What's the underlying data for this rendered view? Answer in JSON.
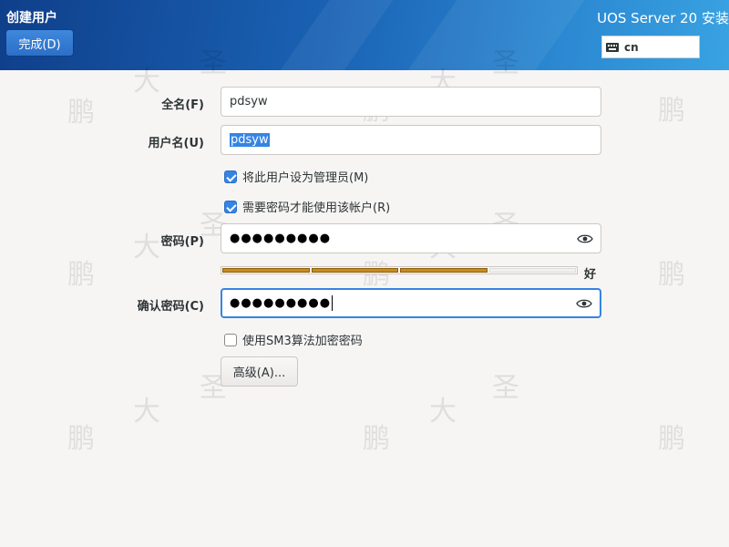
{
  "header": {
    "page_title": "创建用户",
    "done_label": "完成(D)",
    "product_title": "UOS Server 20 安装",
    "keyboard_layout": "cn",
    "keyboard_icon": "keyboard-icon"
  },
  "watermark": [
    "鹏",
    "大",
    "圣"
  ],
  "form": {
    "fullname": {
      "label": "全名(F)",
      "value": "pdsyw"
    },
    "username": {
      "label": "用户名(U)",
      "value": "pdsyw"
    },
    "admin_check": {
      "label": "将此用户设为管理员(M)",
      "checked": true
    },
    "require_pw_check": {
      "label": "需要密码才能使用该帐户(R)",
      "checked": true
    },
    "password": {
      "label": "密码(P)",
      "masked": "●●●●●●●●●",
      "reveal_icon": "eye-icon"
    },
    "strength": {
      "filled_segments": 3,
      "total_segments": 4,
      "label": "好"
    },
    "confirm": {
      "label": "确认密码(C)",
      "masked": "●●●●●●●●●",
      "reveal_icon": "eye-icon"
    },
    "sm3_check": {
      "label": "使用SM3算法加密密码",
      "checked": false
    },
    "advanced_label": "高级(A)..."
  },
  "colors": {
    "accent": "#3584e4",
    "strength_fill": "#c98a1e",
    "header_dark": "#0f3f8a",
    "header_light": "#39a3e2"
  }
}
